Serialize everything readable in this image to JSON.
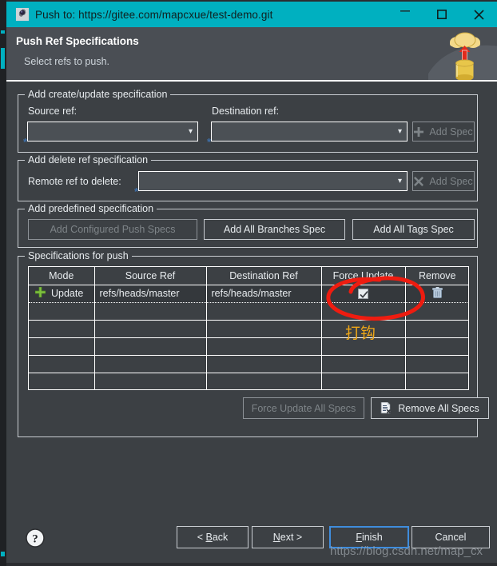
{
  "window": {
    "title": "Push to: https://gitee.com/mapcxue/test-demo.git",
    "icon": "egit-gear-icon",
    "minimize_label": "—",
    "maximize_label": "□",
    "close_label": "✕",
    "accent_color": "#00b0c0",
    "background_color": "#3c4044"
  },
  "header": {
    "title": "Push Ref Specifications",
    "subtitle": "Select refs to push.",
    "graphic": "push-to-cloud-icon"
  },
  "create_update_group": {
    "legend": "Add create/update specification",
    "source_label": "Source ref:",
    "source_value": "",
    "destination_label": "Destination ref:",
    "destination_value": "",
    "add_spec_label": "Add Spec",
    "add_spec_icon": "plus-icon",
    "add_spec_enabled": false
  },
  "delete_group": {
    "legend": "Add delete ref specification",
    "remote_label": "Remote ref to delete:",
    "remote_value": "",
    "add_spec_label": "Add Spec",
    "add_spec_icon": "cross-icon",
    "add_spec_enabled": false
  },
  "predefined_group": {
    "legend": "Add predefined specification",
    "buttons": [
      {
        "label": "Add Configured Push Specs",
        "enabled": false
      },
      {
        "label": "Add All Branches Spec",
        "enabled": true
      },
      {
        "label": "Add All Tags Spec",
        "enabled": true
      }
    ]
  },
  "specs_group": {
    "legend": "Specifications for push",
    "columns": [
      "Mode",
      "Source Ref",
      "Destination Ref",
      "Force Update",
      "Remove"
    ],
    "rows": [
      {
        "mode": "Update",
        "mode_icon": "green-plus-icon",
        "source_ref": "refs/heads/master",
        "destination_ref": "refs/heads/master",
        "force_update": true,
        "remove_icon": "trash-icon",
        "selected": true
      }
    ],
    "empty_row_count": 6,
    "force_update_all_label": "Force Update All Specs",
    "force_update_all_enabled": false,
    "remove_all_label": "Remove All Specs",
    "remove_all_icon": "document-delete-icon",
    "remove_all_enabled": true
  },
  "footer": {
    "help_icon": "help-question-icon",
    "back_label": "< Back",
    "back_mnemonic": "B",
    "next_label": "Next >",
    "next_mnemonic": "N",
    "finish_label": "Finish",
    "finish_mnemonic": "F",
    "cancel_label": "Cancel"
  },
  "annotations": {
    "ellipse_color": "#ee1c10",
    "note_text": "打钩",
    "note_color": "#f0a818",
    "watermark": "https://blog.csdn.net/map_cx"
  }
}
